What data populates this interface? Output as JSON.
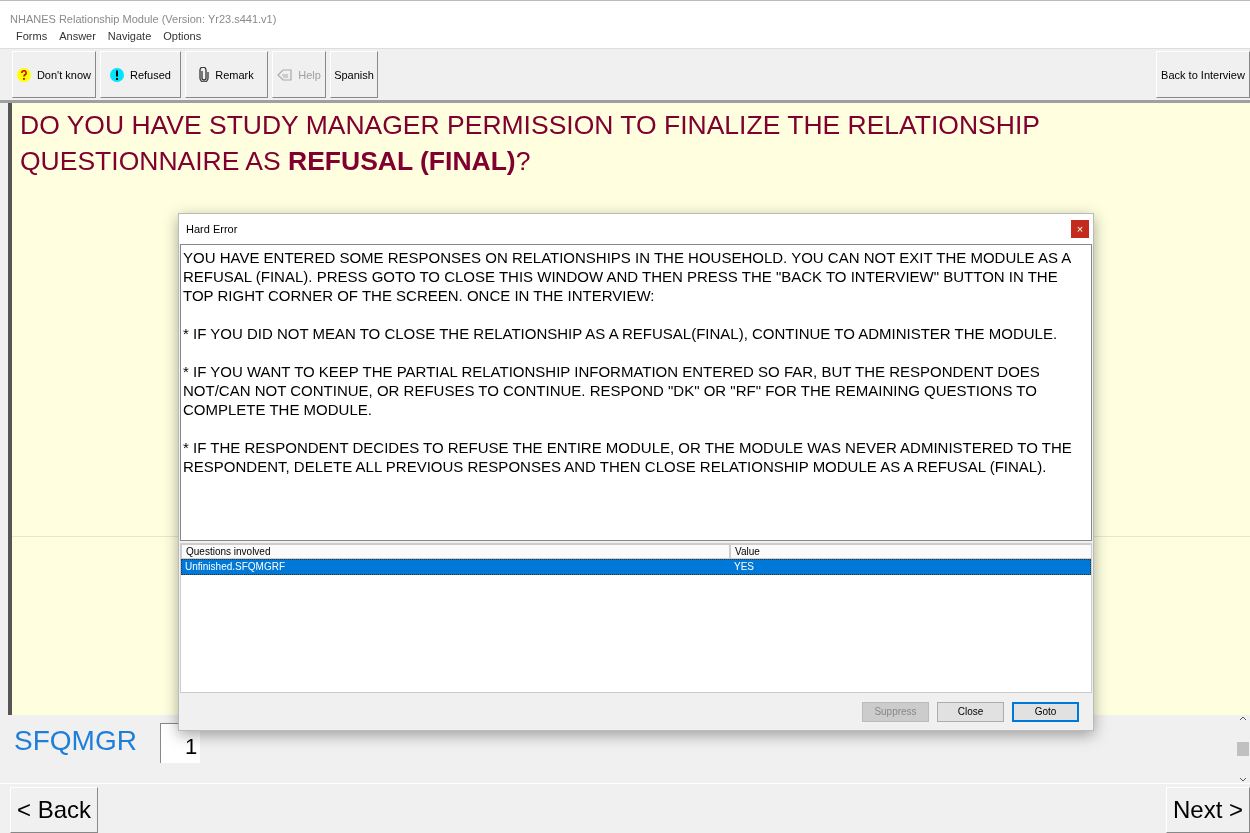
{
  "window": {
    "title": "NHANES Relationship Module (Version: Yr23.s441.v1)"
  },
  "menu": [
    "Forms",
    "Answer",
    "Navigate",
    "Options"
  ],
  "toolbar": [
    {
      "label": "Don't know",
      "kind": "dont_know",
      "disabled": false
    },
    {
      "label": "Refused",
      "kind": "refused",
      "disabled": false
    },
    {
      "label": "Remark",
      "kind": "remark",
      "disabled": false
    },
    {
      "label": "Help",
      "kind": "help",
      "disabled": true
    },
    {
      "label": "Spanish",
      "kind": "plain",
      "disabled": false
    }
  ],
  "back_to_interview": "Back to Interview",
  "question": "DO YOU HAVE STUDY MANAGER PERMISSION TO FINALIZE THE RELATIONSHIP QUESTIONNAIRE AS **REFUSAL (FINAL)**?",
  "dialog": {
    "title": "Hard Error",
    "close": "×",
    "message": [
      "YOU HAVE ENTERED SOME RESPONSES ON RELATIONSHIPS IN THE HOUSEHOLD. YOU CAN NOT EXIT THE MODULE AS A REFUSAL (FINAL). PRESS GOTO TO CLOSE THIS WINDOW AND THEN PRESS THE \"BACK TO INTERVIEW\" BUTTON IN THE TOP RIGHT CORNER OF THE SCREEN. ONCE IN THE INTERVIEW:",
      "* IF YOU DID NOT MEAN TO CLOSE THE RELATIONSHIP AS A REFUSAL(FINAL), CONTINUE TO ADMINISTER THE MODULE.",
      "* IF YOU WANT TO KEEP THE PARTIAL RELATIONSHIP INFORMATION ENTERED SO FAR, BUT THE RESPONDENT DOES NOT/CAN NOT CONTINUE, OR REFUSES TO CONTINUE. RESPOND \"DK\" OR \"RF\" FOR THE REMAINING QUESTIONS TO COMPLETE THE MODULE.",
      "* IF THE RESPONDENT DECIDES TO REFUSE THE ENTIRE MODULE, OR THE MODULE WAS NEVER ADMINISTERED TO THE RESPONDENT, DELETE ALL PREVIOUS RESPONSES AND THEN CLOSE RELATIONSHIP MODULE AS A REFUSAL (FINAL)."
    ],
    "columns": [
      "Questions involved",
      "Value"
    ],
    "rows": [
      {
        "question": "Unfinished.SFQMGRF",
        "value": "YES",
        "selected": true
      }
    ],
    "buttons": [
      {
        "label": "Suppress",
        "disabled": true,
        "focused": false
      },
      {
        "label": "Close",
        "disabled": false,
        "focused": false
      },
      {
        "label": "Goto",
        "disabled": false,
        "focused": true
      }
    ]
  },
  "field": {
    "name": "SFQMGR",
    "value": "1"
  },
  "nav": {
    "back": "< Back",
    "next": "Next >"
  }
}
